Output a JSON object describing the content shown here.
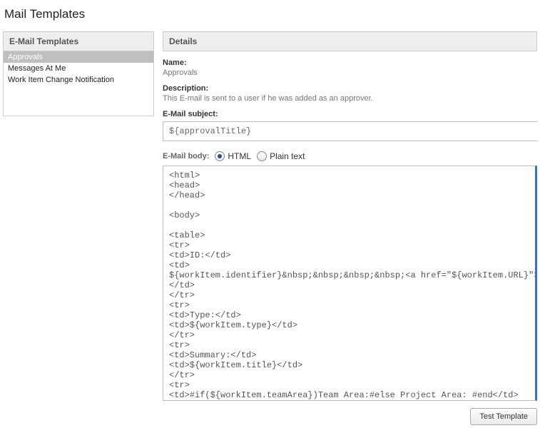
{
  "page": {
    "title": "Mail Templates"
  },
  "leftPanel": {
    "header": "E-Mail Templates",
    "items": [
      {
        "label": "Approvals",
        "selected": true
      },
      {
        "label": "Messages At Me",
        "selected": false
      },
      {
        "label": "Work Item Change Notification",
        "selected": false
      }
    ]
  },
  "details": {
    "header": "Details",
    "nameLabel": "Name:",
    "nameValue": "Approvals",
    "descLabel": "Description:",
    "descValue": "This E-mail is sent to a user if he was added as an approver.",
    "subjectLabel": "E-Mail subject:",
    "subjectValue": "${approvalTitle}",
    "bodyLabel": "E-Mail body:",
    "format": {
      "htmlLabel": "HTML",
      "plainLabel": "Plain text",
      "selected": "html"
    },
    "bodyValue": "<html>\n<head>\n</head>\n\n<body>\n\n<table>\n<tr>\n<td>ID:</td>\n<td>\n${workItem.identifier}&nbsp;&nbsp;&nbsp;&nbsp;<a href=\"${workItem.URL}\">Open in web browser</a>\n</td>\n</tr>\n<tr>\n<td>Type:</td>\n<td>${workItem.type}</td>\n</tr>\n<tr>\n<td>Summary:</td>\n<td>${workItem.title}</td>\n</tr>\n<tr>\n<td>#if(${workItem.teamArea})Team Area:#else Project Area: #end</td>\n<td>#if(${workItem.teamArea}) ${workItem.teamArea} / ${workItem.projectArea}#else"
  },
  "actions": {
    "testTemplate": "Test Template"
  }
}
